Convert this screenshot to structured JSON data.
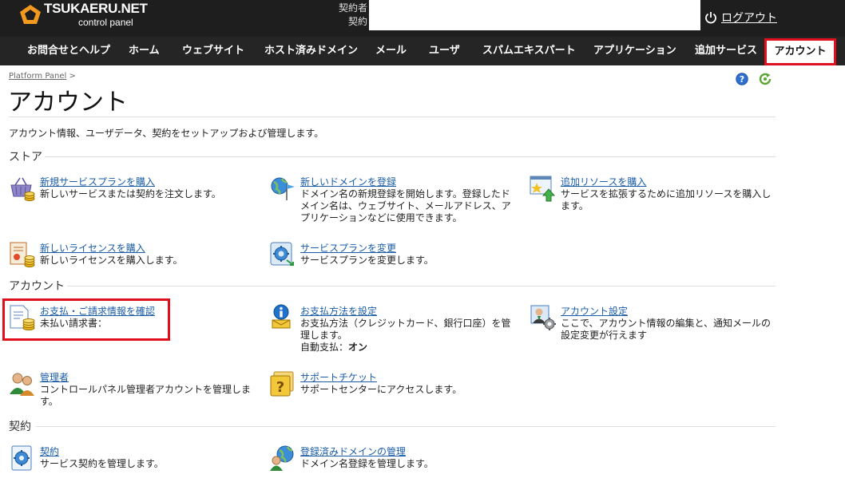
{
  "header": {
    "brand_name": "TSUKAERU.NET",
    "brand_sub": "control panel",
    "contract_label_1": "契約者",
    "contract_label_2": "契約",
    "logout_label": "ログアウト"
  },
  "nav": {
    "items": [
      {
        "label": "お問合せとヘルプ"
      },
      {
        "label": "ホーム"
      },
      {
        "label": "ウェブサイト"
      },
      {
        "label": "ホスト済みドメイン"
      },
      {
        "label": "メール"
      },
      {
        "label": "ユーザ"
      },
      {
        "label": "スパムエキスパート"
      },
      {
        "label": "アプリケーション"
      },
      {
        "label": "追加サービス"
      }
    ],
    "active_label": "アカウント"
  },
  "breadcrumb": {
    "link": "Platform Panel",
    "separator": ">"
  },
  "page": {
    "title": "アカウント",
    "description": "アカウント情報、ユーザデータ、契約をセットアップおよび管理します。"
  },
  "sections": {
    "store": {
      "title": "ストア",
      "tiles": [
        {
          "title": "新規サービスプランを購入",
          "desc": "新しいサービスまたは契約を注文します。",
          "icon": "basket-coins-icon"
        },
        {
          "title": "しいドメインを登録",
          "desc": "ドメイン名の新規登録を開始します。登録したドメイン名は、ウェブサイト、メールアドレス、アプリケーションなどに使用できます。",
          "icon": "globe-flag-icon"
        },
        {
          "title": "追加リソースを購入",
          "desc": "サービスを拡張するために追加リソースを購入します。",
          "icon": "resource-upgrade-icon"
        },
        {
          "title": "新しいライセンスを購入",
          "desc": "新しいライセンスを購入します。",
          "icon": "license-coins-icon"
        },
        {
          "title": "サービスプランを変更",
          "desc": "サービスプランを変更します。",
          "icon": "plan-change-icon"
        }
      ]
    },
    "account": {
      "title": "アカウント",
      "tiles": [
        {
          "title": "お支払・ご請求情報を確認",
          "desc": "未払い請求書：",
          "icon": "invoice-coins-icon"
        },
        {
          "title": "お支払方法を設定",
          "desc": "お支払方法（クレジットカード、銀行口座）を管理します。",
          "extra_label": "自動支払：",
          "extra_value": "オン",
          "icon": "payment-info-icon"
        },
        {
          "title": "アカウント設定",
          "desc": "ここで、アカウント情報の編集と、通知メールの設定変更が行えます",
          "icon": "account-settings-icon"
        },
        {
          "title": "管理者",
          "desc": "コントロールパネル管理者アカウントを管理します。",
          "icon": "administrators-icon"
        },
        {
          "title": "サポートチケット",
          "desc": "サポートセンターにアクセスします。",
          "icon": "support-ticket-icon"
        }
      ]
    },
    "contract": {
      "title": "契約",
      "tiles": [
        {
          "title": "契約",
          "desc": "サービス契約を管理します。",
          "icon": "contract-icon"
        },
        {
          "title": "登録済みドメインの管理",
          "desc": "ドメイン名登録を管理します。",
          "icon": "registered-domain-icon"
        }
      ]
    }
  },
  "colors": {
    "highlight": "#e10e1c",
    "link": "#1a5ca8",
    "topbar": "#1e1e1e"
  }
}
